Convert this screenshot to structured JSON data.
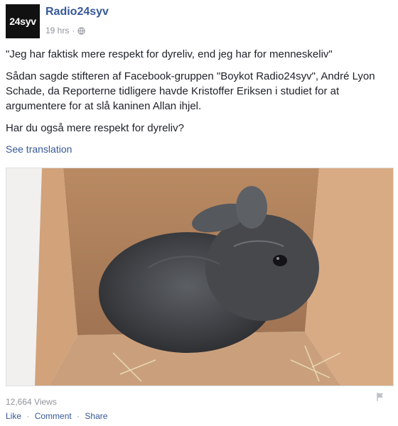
{
  "post": {
    "author": "Radio24syv",
    "avatar_text": "24syv",
    "timestamp": "19 hrs",
    "meta_separator": "·",
    "paragraphs": [
      "\"Jeg har faktisk mere respekt for dyreliv, end jeg har for menneskeliv\"",
      "Sådan sagde stifteren af Facebook-gruppen \"Boykot Radio24syv\", André Lyon Schade, da Reporterne tidligere havde Kristoffer Eriksen i studiet for at argumentere for at slå kaninen Allan ihjel.",
      "Har du også mere respekt for dyreliv?"
    ],
    "see_translation": "See translation",
    "views": "12,664 Views",
    "actions": {
      "like": "Like",
      "comment": "Comment",
      "share": "Share",
      "separator": "·"
    }
  },
  "icons": {
    "audience": "globe-icon",
    "report": "flag-icon"
  },
  "colors": {
    "link": "#365899",
    "secondary_text": "#90949c",
    "avatar_bg": "#111111"
  }
}
